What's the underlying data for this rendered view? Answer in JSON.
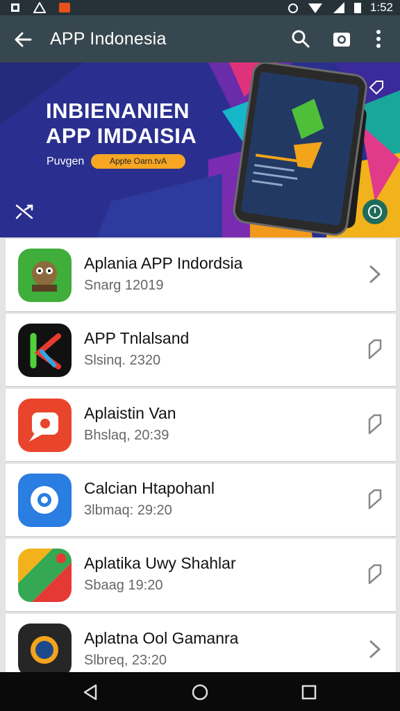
{
  "status_bar": {
    "time": "1:52"
  },
  "app_bar": {
    "title": "APP Indonesia"
  },
  "banner": {
    "headline_line1": "INBIENANIEN",
    "headline_line2": "APP IMDAISIA",
    "sub_label": "Puvgen",
    "pill_text": "Appte Oarn.tvA"
  },
  "apps": [
    {
      "name": "Aplania APP Indordsia",
      "date": "Snarg 12019",
      "trailing_icon": "chevron-right-icon"
    },
    {
      "name": "APP Tnlalsand",
      "date": "Slsinq. 2320",
      "trailing_icon": "bookmark-icon"
    },
    {
      "name": "Aplaistin Van",
      "date": "Bhslaq, 20:39",
      "trailing_icon": "bookmark-icon"
    },
    {
      "name": "Calcian Htapohanl",
      "date": "3lbmaq: 29:20",
      "trailing_icon": "bookmark-icon"
    },
    {
      "name": "Aplatika Uwy Shahlar",
      "date": "Sbaag 19:20",
      "trailing_icon": "bookmark-icon"
    },
    {
      "name": "Aplatna Ool Gamanra",
      "date": "Slbreq, 23:20",
      "trailing_icon": "chevron-right-icon"
    }
  ],
  "colors": {
    "app_bar": "#37474f",
    "status_bar": "#263238",
    "banner_base": "#2a2f8f",
    "pill": "#f6a623"
  }
}
